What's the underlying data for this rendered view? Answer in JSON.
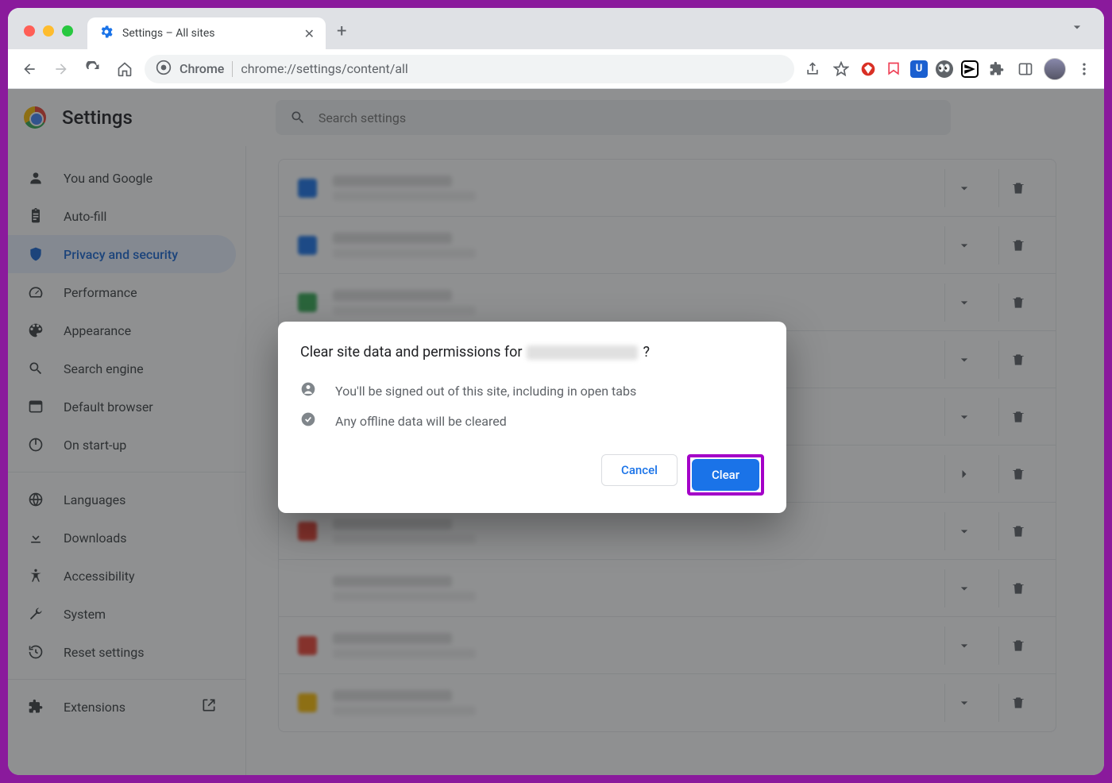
{
  "tab": {
    "title": "Settings – All sites"
  },
  "addressbar": {
    "label": "Chrome",
    "url": "chrome://settings/content/all"
  },
  "header": {
    "title": "Settings"
  },
  "search": {
    "placeholder": "Search settings"
  },
  "sidebar": {
    "items": [
      {
        "label": "You and Google",
        "icon": "person"
      },
      {
        "label": "Auto-fill",
        "icon": "clipboard"
      },
      {
        "label": "Privacy and security",
        "icon": "shield",
        "active": true
      },
      {
        "label": "Performance",
        "icon": "speed"
      },
      {
        "label": "Appearance",
        "icon": "palette"
      },
      {
        "label": "Search engine",
        "icon": "search"
      },
      {
        "label": "Default browser",
        "icon": "browser"
      },
      {
        "label": "On start-up",
        "icon": "power"
      }
    ],
    "secondary": [
      {
        "label": "Languages",
        "icon": "globe"
      },
      {
        "label": "Downloads",
        "icon": "download"
      },
      {
        "label": "Accessibility",
        "icon": "accessibility"
      },
      {
        "label": "System",
        "icon": "wrench"
      },
      {
        "label": "Reset settings",
        "icon": "restore"
      }
    ],
    "extensions_label": "Extensions"
  },
  "dialog": {
    "title_prefix": "Clear site data and permissions for",
    "title_suffix": "?",
    "info1": "You'll be signed out of this site, including in open tabs",
    "info2": "Any offline data will be cleared",
    "cancel": "Cancel",
    "clear": "Clear"
  },
  "site_rows": [
    {
      "favicon": "#1a73e8"
    },
    {
      "favicon": "#1a73e8"
    },
    {
      "favicon": "#34a853"
    },
    {
      "favicon": "#9aa0a6"
    },
    {
      "favicon": "#9aa0a6"
    },
    {
      "favicon": "#9aa0a6",
      "expand_type": "right"
    },
    {
      "favicon": "#ea4335"
    },
    {
      "favicon": "#fff"
    },
    {
      "favicon": "#ea4335"
    },
    {
      "favicon": "#fbbc05"
    }
  ]
}
